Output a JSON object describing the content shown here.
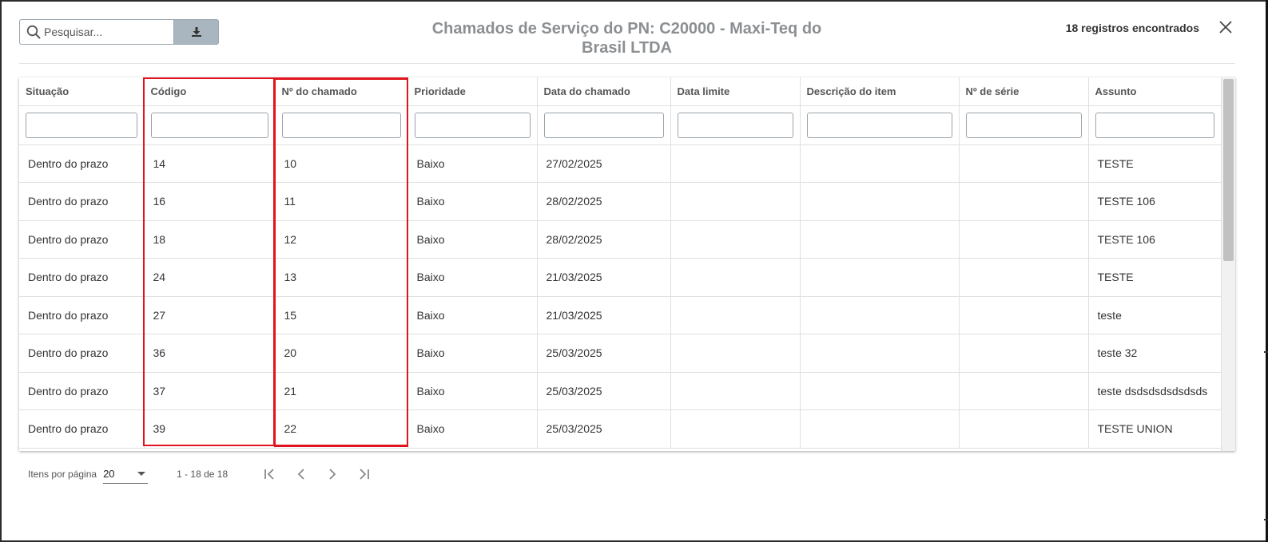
{
  "search": {
    "placeholder": "Pesquisar..."
  },
  "header": {
    "title": "Chamados de Serviço do PN: C20000 - Maxi-Teq do Brasil LTDA",
    "record_count": "18 registros encontrados"
  },
  "table": {
    "columns": [
      "Situação",
      "Código",
      "Nº do chamado",
      "Prioridade",
      "Data do chamado",
      "Data limite",
      "Descrição do item",
      "Nº de série",
      "Assunto"
    ],
    "rows": [
      [
        "Dentro do prazo",
        "14",
        "10",
        "Baixo",
        "27/02/2025",
        "",
        "",
        "",
        "TESTE"
      ],
      [
        "Dentro do prazo",
        "16",
        "11",
        "Baixo",
        "28/02/2025",
        "",
        "",
        "",
        "TESTE 106"
      ],
      [
        "Dentro do prazo",
        "18",
        "12",
        "Baixo",
        "28/02/2025",
        "",
        "",
        "",
        "TESTE 106"
      ],
      [
        "Dentro do prazo",
        "24",
        "13",
        "Baixo",
        "21/03/2025",
        "",
        "",
        "",
        "TESTE"
      ],
      [
        "Dentro do prazo",
        "27",
        "15",
        "Baixo",
        "21/03/2025",
        "",
        "",
        "",
        "teste"
      ],
      [
        "Dentro do prazo",
        "36",
        "20",
        "Baixo",
        "25/03/2025",
        "",
        "",
        "",
        "teste 32"
      ],
      [
        "Dentro do prazo",
        "37",
        "21",
        "Baixo",
        "25/03/2025",
        "",
        "",
        "",
        "teste dsdsdsdsdsdsds"
      ],
      [
        "Dentro do prazo",
        "39",
        "22",
        "Baixo",
        "25/03/2025",
        "",
        "",
        "",
        "TESTE UNION"
      ]
    ]
  },
  "paginator": {
    "items_per_page_label": "Itens por página",
    "items_per_page": "20",
    "range_label": "1 - 18 de 18"
  },
  "colors": {
    "highlight": "#e0141e",
    "download_button": "#aab6bf",
    "title": "#8c8f92"
  },
  "icons": {
    "search": "search-icon",
    "download": "download-icon",
    "close": "close-icon",
    "first": "first-page-icon",
    "prev": "prev-page-icon",
    "next": "next-page-icon",
    "last": "last-page-icon"
  }
}
